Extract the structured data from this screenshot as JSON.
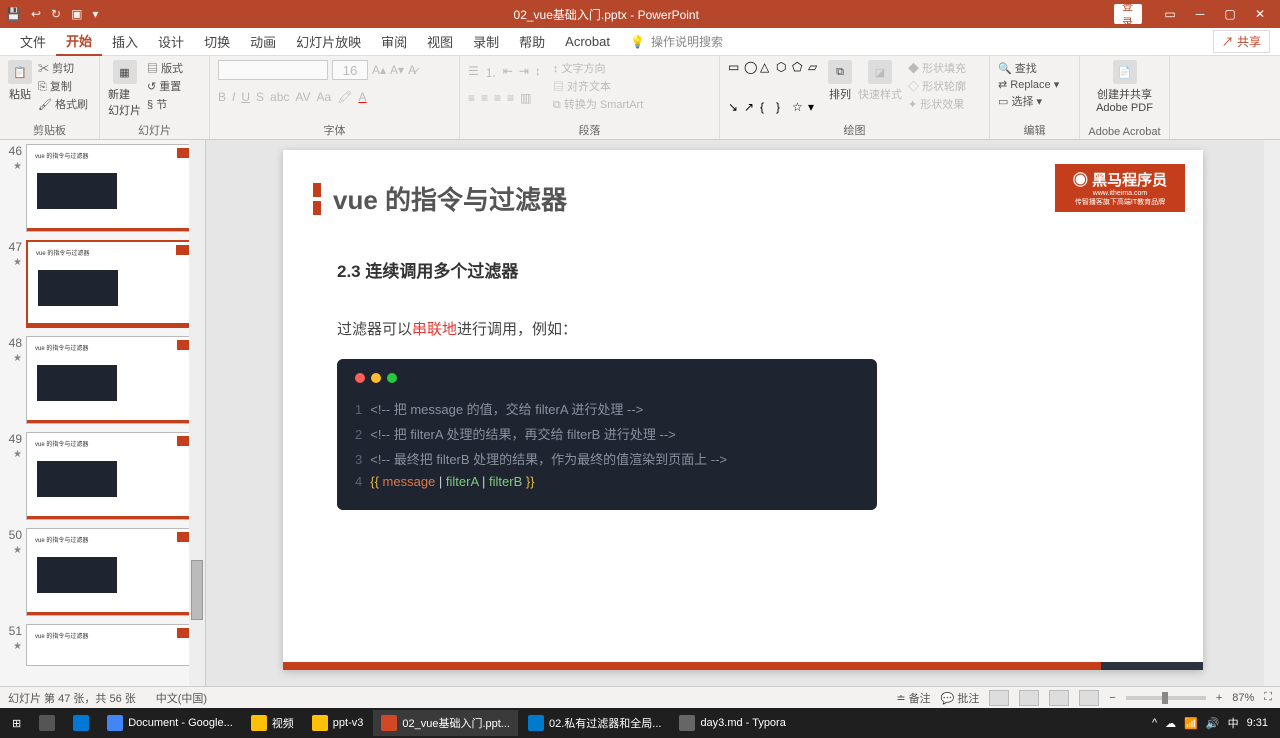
{
  "titlebar": {
    "filename": "02_vue基础入门.pptx - PowerPoint",
    "login": "登录"
  },
  "tabs": [
    "文件",
    "开始",
    "插入",
    "设计",
    "切换",
    "动画",
    "幻灯片放映",
    "审阅",
    "视图",
    "录制",
    "帮助",
    "Acrobat"
  ],
  "tellme": "操作说明搜索",
  "share": "共享",
  "ribbon": {
    "clipboard": {
      "label": "剪贴板",
      "paste": "粘贴",
      "cut": "剪切",
      "copy": "复制",
      "format": "格式刷"
    },
    "slides": {
      "label": "幻灯片",
      "new": "新建\n幻灯片",
      "layout": "版式",
      "reset": "重置",
      "section": "节"
    },
    "font": {
      "label": "字体",
      "size": "16"
    },
    "paragraph": {
      "label": "段落",
      "dir": "文字方向",
      "align": "对齐文本",
      "smart": "转换为 SmartArt"
    },
    "drawing": {
      "label": "绘图",
      "arrange": "排列",
      "quick": "快速样式",
      "fill": "形状填充",
      "outline": "形状轮廓",
      "effect": "形状效果"
    },
    "editing": {
      "label": "编辑",
      "find": "查找",
      "replace": "Replace",
      "select": "选择"
    },
    "adobe": {
      "label": "Adobe Acrobat",
      "btn": "创建并共享\nAdobe PDF"
    }
  },
  "thumbs": [
    {
      "num": "46"
    },
    {
      "num": "47"
    },
    {
      "num": "48"
    },
    {
      "num": "49"
    },
    {
      "num": "50"
    },
    {
      "num": "51"
    }
  ],
  "slide": {
    "logo": {
      "main": "黑马程序员",
      "sub": "www.itheima.com",
      "tag": "传智播客旗下高端IT教育品牌"
    },
    "title": "vue 的指令与过滤器",
    "section": "2.3 连续调用多个过滤器",
    "desc_pre": "过滤器可以",
    "desc_hl": "串联地",
    "desc_post": "进行调用，例如：",
    "code": [
      {
        "n": "1",
        "t": "<!-- 把 message 的值，交给 filterA 进行处理 -->",
        "c": "cm"
      },
      {
        "n": "2",
        "t": "<!-- 把 filterA 处理的结果，再交给 filterB 进行处理 -->",
        "c": "cm"
      },
      {
        "n": "3",
        "t": "<!-- 最终把 filterB 处理的结果，作为最终的值渲染到页面上 -->",
        "c": "cm"
      }
    ],
    "code4": {
      "n": "4",
      "open": "{{ ",
      "msg": "message",
      "pipe": " | ",
      "fa": "filterA",
      "fb": "filterB",
      "close": " }}"
    }
  },
  "status": {
    "slide": "幻灯片 第 47 张，共 56 张",
    "lang": "中文(中国)",
    "notes": "备注",
    "comments": "批注",
    "zoom": "87%"
  },
  "task": {
    "items": [
      "Document - Google...",
      "视频",
      "ppt-v3",
      "02_vue基础入门.ppt...",
      "02.私有过滤器和全局...",
      "day3.md - Typora"
    ],
    "time": "9:31",
    "date": "中"
  }
}
